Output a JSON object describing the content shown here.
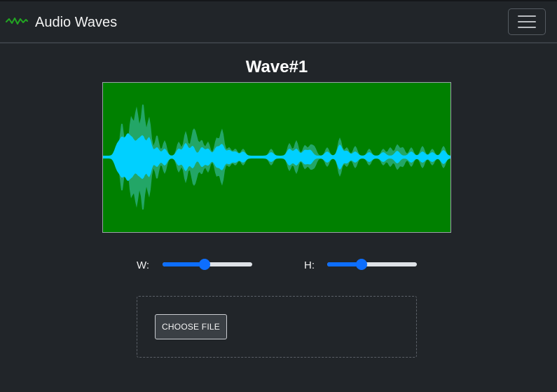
{
  "app": {
    "brand_icon": "waveform-icon",
    "brand_name": "Audio Waves",
    "menu_icon": "hamburger-menu-icon"
  },
  "wave": {
    "title": "Wave#1",
    "background_color": "#008000",
    "outer_color": "#2fb389",
    "inner_color": "#00d0ff"
  },
  "controls": {
    "width_label": "W:",
    "width_value": 0.47,
    "height_label": "H:",
    "height_value": 0.38
  },
  "upload": {
    "button_label": "CHOOSE FILE"
  }
}
